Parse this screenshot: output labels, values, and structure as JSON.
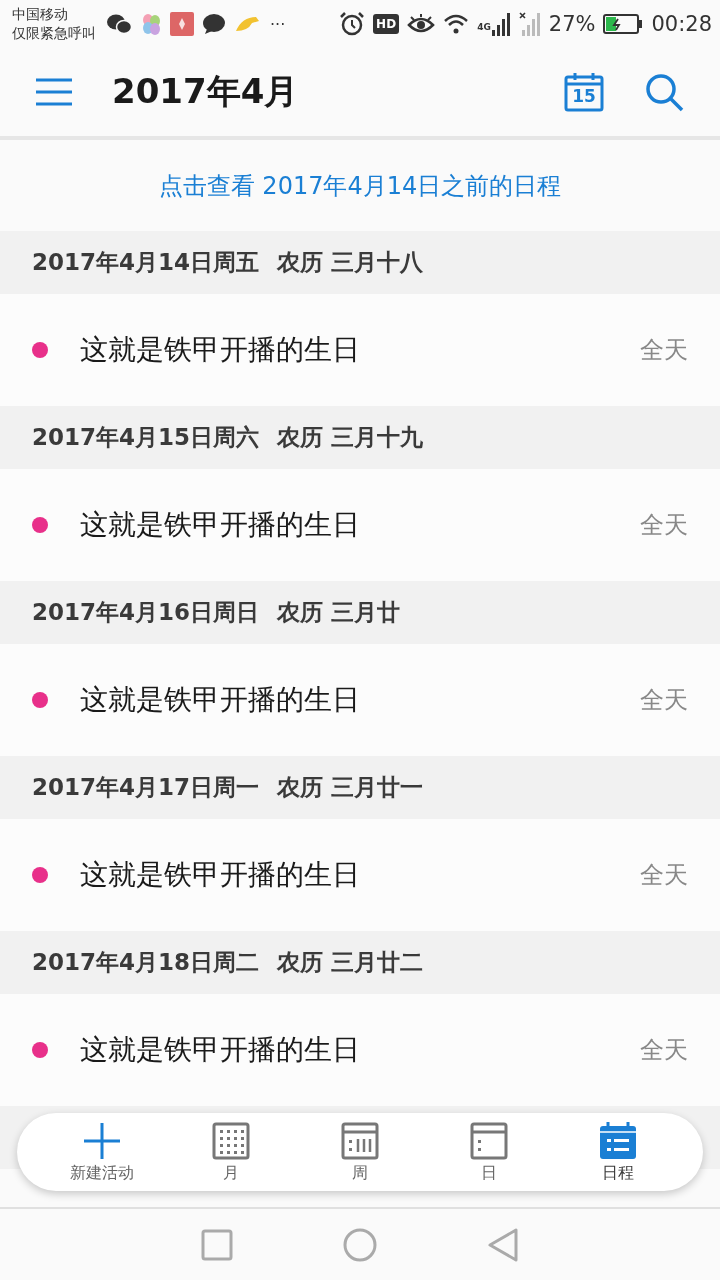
{
  "status_bar": {
    "carrier": "中国移动",
    "carrier_note": "仅限紧急呼叫",
    "more": "···",
    "hd": "HD",
    "network": "4G",
    "battery": "27%",
    "time": "00:28",
    "charging": true
  },
  "app_bar": {
    "title": "2017年4月",
    "calendar_day": "15"
  },
  "banner": "点击查看 2017年4月14日之前的日程",
  "days": [
    {
      "date": "2017年4月14日周五",
      "lunar": "农历 三月十八",
      "events": [
        {
          "title": "这就是铁甲开播的生日",
          "time": "全天",
          "color": "#e8308a"
        }
      ]
    },
    {
      "date": "2017年4月15日周六",
      "lunar": "农历 三月十九",
      "events": [
        {
          "title": "这就是铁甲开播的生日",
          "time": "全天",
          "color": "#e8308a"
        }
      ]
    },
    {
      "date": "2017年4月16日周日",
      "lunar": "农历 三月廿",
      "events": [
        {
          "title": "这就是铁甲开播的生日",
          "time": "全天",
          "color": "#e8308a"
        }
      ]
    },
    {
      "date": "2017年4月17日周一",
      "lunar": "农历 三月廿一",
      "events": [
        {
          "title": "这就是铁甲开播的生日",
          "time": "全天",
          "color": "#e8308a"
        }
      ]
    },
    {
      "date": "2017年4月18日周二",
      "lunar": "农历 三月廿二",
      "events": [
        {
          "title": "这就是铁甲开播的生日",
          "time": "全天",
          "color": "#e8308a"
        }
      ]
    }
  ],
  "bottom_nav": [
    {
      "kind": "add",
      "label": "新建活动",
      "selected": false
    },
    {
      "kind": "month",
      "label": "月",
      "selected": false
    },
    {
      "kind": "week",
      "label": "周",
      "selected": false
    },
    {
      "kind": "day",
      "label": "日",
      "selected": false
    },
    {
      "kind": "agenda",
      "label": "日程",
      "selected": true
    }
  ]
}
